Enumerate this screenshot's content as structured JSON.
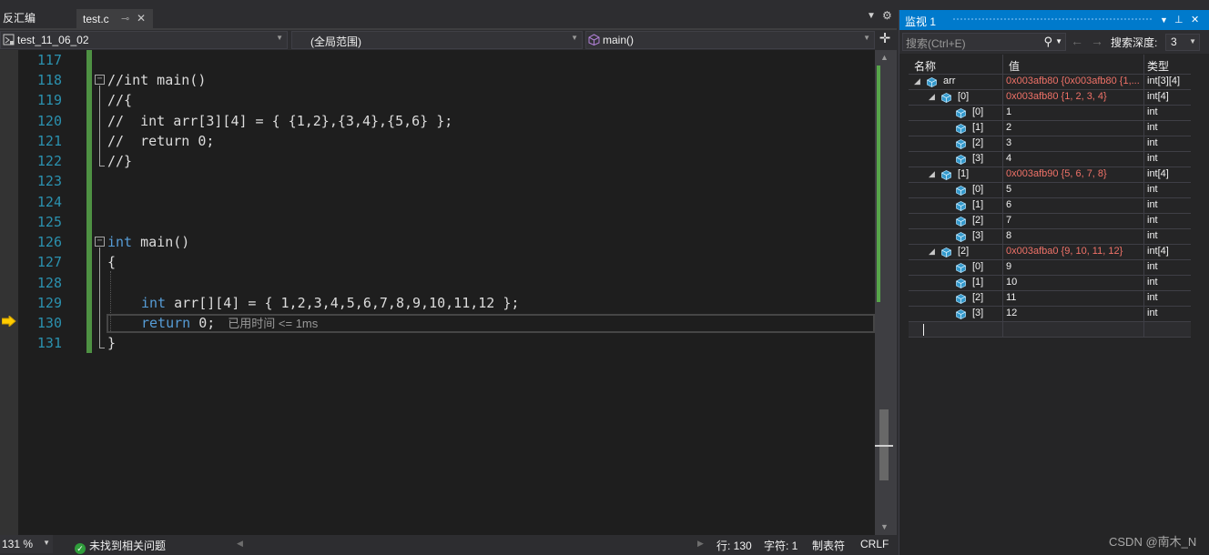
{
  "editor": {
    "disasm_tab": "反汇编",
    "file_tab": "test.c",
    "project_combo": "test_11_06_02",
    "scope_combo": "(全局范围)",
    "function_combo": "main()",
    "perf_tip": "已用时间 <= 1ms",
    "lines": [
      {
        "num": "117",
        "text": ""
      },
      {
        "num": "118",
        "text": "//int main()"
      },
      {
        "num": "119",
        "text": "//{"
      },
      {
        "num": "120",
        "text": "//  int arr[3][4] = { {1,2},{3,4},{5,6} };"
      },
      {
        "num": "121",
        "text": "//  return 0;"
      },
      {
        "num": "122",
        "text": "//}"
      },
      {
        "num": "123",
        "text": ""
      },
      {
        "num": "124",
        "text": ""
      },
      {
        "num": "125",
        "text": ""
      },
      {
        "num": "126",
        "text": "int main()"
      },
      {
        "num": "127",
        "text": "{"
      },
      {
        "num": "128",
        "text": ""
      },
      {
        "num": "129",
        "text": "int arr[][4] = { 1,2,3,4,5,6,7,8,9,10,11,12 };"
      },
      {
        "num": "130",
        "text": "return 0;"
      },
      {
        "num": "131",
        "text": "}"
      }
    ]
  },
  "status": {
    "zoom": "131 %",
    "issues": "未找到相关问题",
    "line": "行: 130",
    "char": "字符: 1",
    "tabs": "制表符",
    "eol": "CRLF"
  },
  "watch": {
    "title": "监视 1",
    "search_placeholder": "搜索(Ctrl+E)",
    "depth_label": "搜索深度:",
    "depth_value": "3",
    "columns": {
      "name": "名称",
      "value": "值",
      "type": "类型"
    },
    "rows": [
      {
        "level": 0,
        "expand": "◢",
        "name": "arr",
        "value": "0x003afb80 {0x003afb80 {1,...",
        "type": "int[3][4]"
      },
      {
        "level": 1,
        "expand": "◢",
        "name": "[0]",
        "value": "0x003afb80 {1, 2, 3, 4}",
        "type": "int[4]"
      },
      {
        "level": 2,
        "expand": "",
        "name": "[0]",
        "value": "1",
        "type": "int"
      },
      {
        "level": 2,
        "expand": "",
        "name": "[1]",
        "value": "2",
        "type": "int"
      },
      {
        "level": 2,
        "expand": "",
        "name": "[2]",
        "value": "3",
        "type": "int"
      },
      {
        "level": 2,
        "expand": "",
        "name": "[3]",
        "value": "4",
        "type": "int"
      },
      {
        "level": 1,
        "expand": "◢",
        "name": "[1]",
        "value": "0x003afb90 {5, 6, 7, 8}",
        "type": "int[4]"
      },
      {
        "level": 2,
        "expand": "",
        "name": "[0]",
        "value": "5",
        "type": "int"
      },
      {
        "level": 2,
        "expand": "",
        "name": "[1]",
        "value": "6",
        "type": "int"
      },
      {
        "level": 2,
        "expand": "",
        "name": "[2]",
        "value": "7",
        "type": "int"
      },
      {
        "level": 2,
        "expand": "",
        "name": "[3]",
        "value": "8",
        "type": "int"
      },
      {
        "level": 1,
        "expand": "◢",
        "name": "[2]",
        "value": "0x003afba0 {9, 10, 11, 12}",
        "type": "int[4]"
      },
      {
        "level": 2,
        "expand": "",
        "name": "[0]",
        "value": "9",
        "type": "int"
      },
      {
        "level": 2,
        "expand": "",
        "name": "[1]",
        "value": "10",
        "type": "int"
      },
      {
        "level": 2,
        "expand": "",
        "name": "[2]",
        "value": "11",
        "type": "int"
      },
      {
        "level": 2,
        "expand": "",
        "name": "[3]",
        "value": "12",
        "type": "int"
      }
    ]
  },
  "watermark": "CSDN @南木_N",
  "colors": {
    "keyword": "#569cd6",
    "comment": "#57a64a",
    "line_number": "#2b91af",
    "changed_value": "#f07268",
    "accent": "#007acc"
  }
}
